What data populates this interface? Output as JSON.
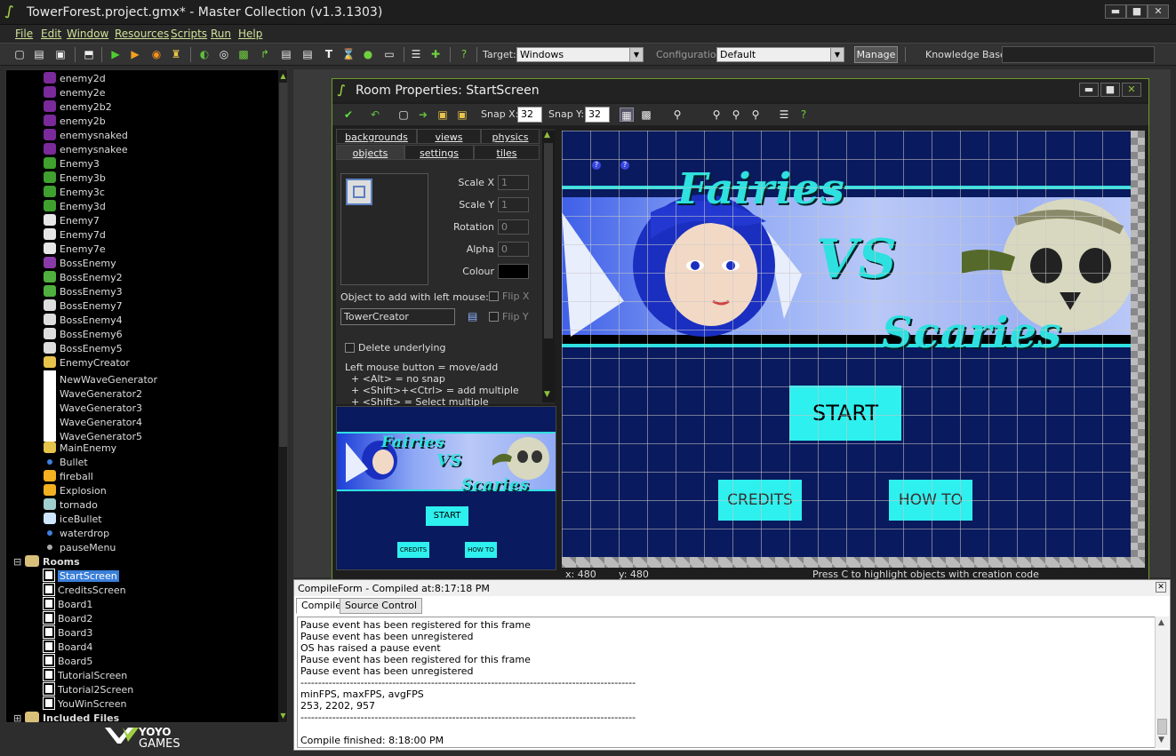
{
  "window": {
    "title": "TowerForest.project.gmx*  -  Master Collection (v1.3.1303)",
    "min": "▬",
    "max": "■",
    "close": "✕"
  },
  "menu": [
    "File",
    "Edit",
    "Window",
    "Resources",
    "Scripts",
    "Run",
    "Help"
  ],
  "toolbar": {
    "target_label": "Target:",
    "target_value": "Windows",
    "config_label": "Configuration:",
    "config_value": "Default",
    "manage_label": "Manage",
    "kb_label": "Knowledge Base:",
    "kb_value": ""
  },
  "tree": {
    "objects": [
      {
        "label": "enemy2d",
        "icon": "purple-bat"
      },
      {
        "label": "enemy2e",
        "icon": "purple-bat"
      },
      {
        "label": "enemy2b2",
        "icon": "purple-bat"
      },
      {
        "label": "enemy2b",
        "icon": "purple-bat"
      },
      {
        "label": "enemysnaked",
        "icon": "purple-bat"
      },
      {
        "label": "enemysnakee",
        "icon": "purple-bat"
      },
      {
        "label": "Enemy3",
        "icon": "green-goblin"
      },
      {
        "label": "Enemy3b",
        "icon": "green-goblin"
      },
      {
        "label": "Enemy3c",
        "icon": "green-goblin"
      },
      {
        "label": "Enemy3d",
        "icon": "green-goblin"
      },
      {
        "label": "Enemy7",
        "icon": "white-skull"
      },
      {
        "label": "Enemy7d",
        "icon": "white-skull"
      },
      {
        "label": "Enemy7e",
        "icon": "white-skull"
      },
      {
        "label": "BossEnemy",
        "icon": "purple-boss"
      },
      {
        "label": "BossEnemy2",
        "icon": "green-boss"
      },
      {
        "label": "BossEnemy3",
        "icon": "green-boss"
      },
      {
        "label": "BossEnemy7",
        "icon": "white-boss"
      },
      {
        "label": "BossEnemy4",
        "icon": "white-boss"
      },
      {
        "label": "BossEnemy6",
        "icon": "white-boss"
      },
      {
        "label": "BossEnemy5",
        "icon": "white-boss"
      },
      {
        "label": "EnemyCreator",
        "icon": "yellow-skull"
      },
      {
        "label": "NewWaveGenerator",
        "icon": "white-box"
      },
      {
        "label": "WaveGenerator2",
        "icon": "white-box"
      },
      {
        "label": "WaveGenerator3",
        "icon": "white-box"
      },
      {
        "label": "WaveGenerator4",
        "icon": "white-box"
      },
      {
        "label": "WaveGenerator5",
        "icon": "white-box"
      },
      {
        "label": "MainEnemy",
        "icon": "yellow-skull"
      },
      {
        "label": "Bullet",
        "icon": "blue-dot"
      },
      {
        "label": "fireball",
        "icon": "fire"
      },
      {
        "label": "Explosion",
        "icon": "fire"
      },
      {
        "label": "tornado",
        "icon": "tornado"
      },
      {
        "label": "iceBullet",
        "icon": "ice"
      },
      {
        "label": "waterdrop",
        "icon": "blue-dot"
      },
      {
        "label": "pauseMenu",
        "icon": "dash"
      }
    ],
    "rooms_group": "Rooms",
    "rooms": [
      "StartScreen",
      "CreditsScreen",
      "Board1",
      "Board2",
      "Board3",
      "Board4",
      "Board5",
      "TutorialScreen",
      "Tutorial2Screen",
      "YouWinScreen"
    ],
    "included_files": "Included Files"
  },
  "logo": {
    "brand": "YOYO",
    "sub": "GAMES"
  },
  "room": {
    "title": "Room Properties: StartScreen",
    "snap_x_label": "Snap X:",
    "snap_x": "32",
    "snap_y_label": "Snap Y:",
    "snap_y": "32",
    "tabs_row1": [
      "backgrounds",
      "views",
      "physics"
    ],
    "tabs_row2": [
      "objects",
      "settings",
      "tiles"
    ],
    "fields": [
      {
        "label": "Scale X",
        "value": "1"
      },
      {
        "label": "Scale Y",
        "value": "1"
      },
      {
        "label": "Rotation",
        "value": "0"
      },
      {
        "label": "Alpha",
        "value": "0"
      }
    ],
    "colour_label": "Colour",
    "colour_value": "#000000",
    "object_to_add_label": "Object to add with left mouse:",
    "object_to_add_value": "TowerCreator",
    "flip_x": "Flip X",
    "flip_y": "Flip Y",
    "delete_underlying": "Delete underlying",
    "help": [
      "Left mouse button = move/add",
      "  + <Alt> = no snap",
      "  + <Shift>+<Ctrl> = add multiple",
      "  + <Shift> = Select multiple"
    ],
    "status_x": "x: 480",
    "status_y": "y: 480",
    "status_hint": "Press C to highlight objects with creation code"
  },
  "scene": {
    "title_fairies": "Fairies",
    "title_vs": "VS",
    "title_scaries": "Scaries",
    "btn_start": "START",
    "btn_credits": "CREDITS",
    "btn_howto": "HOW TO"
  },
  "compile": {
    "header": "CompileForm - Compiled at:8:17:18 PM",
    "tabs": [
      "Compile",
      "Source Control"
    ],
    "log": [
      "Pause event has been registered for this frame",
      "Pause event has been unregistered",
      "OS has raised a pause event",
      "Pause event has been registered for this frame",
      "Pause event has been unregistered",
      "-----------------------------------------------------------------------------------------------",
      "minFPS, maxFPS, avgFPS",
      "253, 2202, 957",
      "-----------------------------------------------------------------------------------------------",
      "Compile finished: 8:18:00 PM"
    ]
  }
}
